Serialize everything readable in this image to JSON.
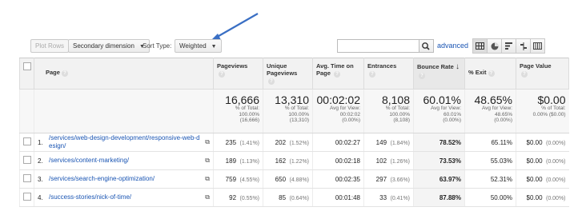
{
  "toolbar": {
    "plot_rows": "Plot Rows",
    "secondary_dimension": "Secondary dimension",
    "sort_type_label": "Sort Type:",
    "sort_type_value": "Weighted",
    "search_value": "",
    "advanced": "advanced"
  },
  "table": {
    "headers": {
      "page": "Page",
      "pageviews": "Pageviews",
      "unique_pageviews": "Unique Pageviews",
      "avg_time": "Avg. Time on Page",
      "entrances": "Entrances",
      "bounce_rate": "Bounce Rate",
      "exit": "% Exit",
      "page_value": "Page Value"
    },
    "totals": {
      "pageviews": {
        "big": "16,666",
        "l1": "% of Total:",
        "l2": "100.00%",
        "l3": "(16,666)"
      },
      "unique": {
        "big": "13,310",
        "l1": "% of Total:",
        "l2": "100.00%",
        "l3": "(13,310)"
      },
      "avg_time": {
        "big": "00:02:02",
        "l1": "Avg for View:",
        "l2": "00:02:02",
        "l3": "(0.00%)"
      },
      "entrances": {
        "big": "8,108",
        "l1": "% of Total:",
        "l2": "100.00%",
        "l3": "(8,108)"
      },
      "bounce": {
        "big": "60.01%",
        "l1": "Avg for View:",
        "l2": "60.01%",
        "l3": "(0.00%)"
      },
      "exit": {
        "big": "48.65%",
        "l1": "Avg for View:",
        "l2": "48.65%",
        "l3": "(0.00%)"
      },
      "value": {
        "big": "$0.00",
        "l1": "% of Total:",
        "l2": "0.00% ($0.00)",
        "l3": ""
      }
    },
    "rows": [
      {
        "idx": "1.",
        "page": "/services/web-design-development/responsive-web-design/",
        "pv": "235",
        "pv_pct": "(1.41%)",
        "upv": "202",
        "upv_pct": "(1.52%)",
        "time": "00:02:27",
        "ent": "149",
        "ent_pct": "(1.84%)",
        "bounce": "78.52%",
        "exit": "65.11%",
        "val": "$0.00",
        "val_pct": "(0.00%)"
      },
      {
        "idx": "2.",
        "page": "/services/content-marketing/",
        "pv": "189",
        "pv_pct": "(1.13%)",
        "upv": "162",
        "upv_pct": "(1.22%)",
        "time": "00:02:18",
        "ent": "102",
        "ent_pct": "(1.26%)",
        "bounce": "73.53%",
        "exit": "55.03%",
        "val": "$0.00",
        "val_pct": "(0.00%)"
      },
      {
        "idx": "3.",
        "page": "/services/search-engine-optimization/",
        "pv": "759",
        "pv_pct": "(4.55%)",
        "upv": "650",
        "upv_pct": "(4.88%)",
        "time": "00:02:35",
        "ent": "297",
        "ent_pct": "(3.66%)",
        "bounce": "63.97%",
        "exit": "52.31%",
        "val": "$0.00",
        "val_pct": "(0.00%)"
      },
      {
        "idx": "4.",
        "page": "/success-stories/nick-of-time/",
        "pv": "92",
        "pv_pct": "(0.55%)",
        "upv": "85",
        "upv_pct": "(0.64%)",
        "time": "00:01:48",
        "ent": "33",
        "ent_pct": "(0.41%)",
        "bounce": "87.88%",
        "exit": "50.00%",
        "val": "$0.00",
        "val_pct": "(0.00%)"
      }
    ]
  },
  "colors": {
    "accent": "#1a55b3",
    "annotation_arrow": "#3a6fc4"
  },
  "icons": [
    "help-icon",
    "search-icon",
    "sort-down-icon",
    "external-link-icon",
    "table-view-icon",
    "pie-view-icon",
    "bar-view-icon",
    "compare-view-icon",
    "pivot-view-icon"
  ]
}
